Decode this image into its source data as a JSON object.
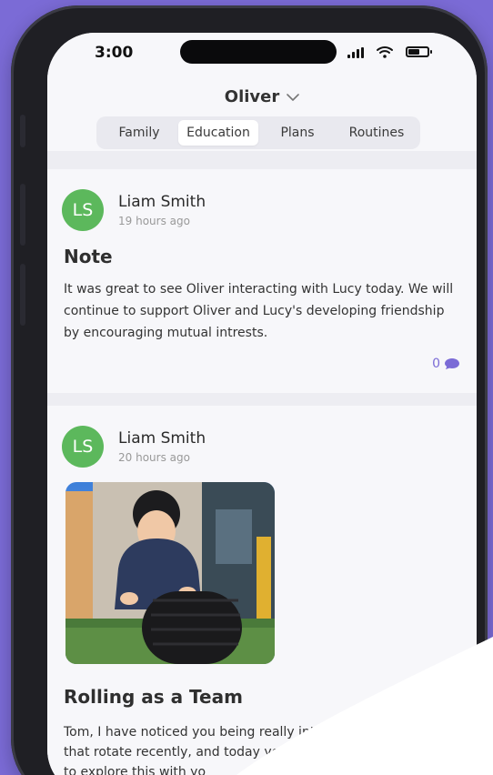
{
  "status_bar": {
    "time": "3:00"
  },
  "header": {
    "child_name": "Oliver",
    "tabs": [
      {
        "label": "Family"
      },
      {
        "label": "Education",
        "active": true
      },
      {
        "label": "Plans"
      },
      {
        "label": "Routines"
      }
    ]
  },
  "posts": [
    {
      "initials": "LS",
      "author": "Liam Smith",
      "time_ago": "19 hours ago",
      "title": "Note",
      "body": "It was great to see Oliver interacting with Lucy today. We will continue to support Oliver and Lucy's developing friendship by encouraging mutual intrests.",
      "comment_count": "0"
    },
    {
      "initials": "LS",
      "author": "Liam Smith",
      "time_ago": "20 hours ago",
      "title": "Rolling as a Team",
      "body_lines": [
        "Tom, I have noticed you being really interes",
        "that rotate recently, and today yo",
        "to explore this with yo"
      ]
    }
  ],
  "colors": {
    "background": "#7b6bd6",
    "avatar": "#5cb85c",
    "accent": "#7b6bd6"
  },
  "icons": [
    "signal-icon",
    "wifi-icon",
    "battery-icon",
    "chevron-down-icon",
    "comment-icon"
  ]
}
